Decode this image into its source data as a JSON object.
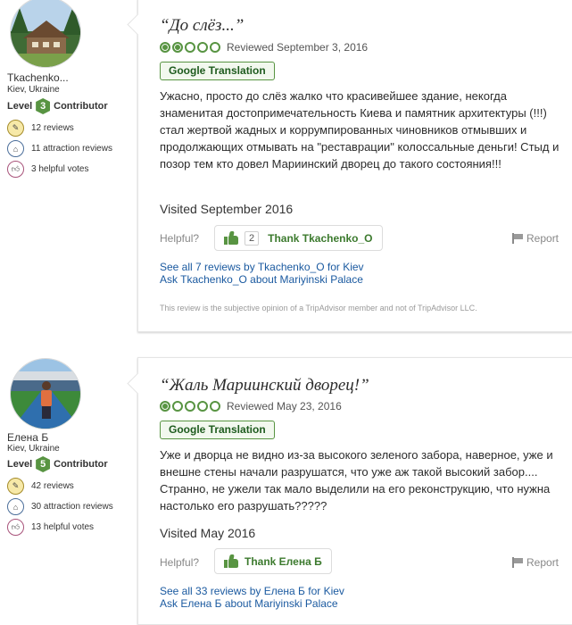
{
  "reviews": [
    {
      "member": {
        "name": "Tkachenko...",
        "location": "Kiev, Ukraine",
        "level_prefix": "Level",
        "level": "3",
        "level_suffix": "Contributor",
        "stats": [
          {
            "icon": "pencil-icon",
            "text": "12 reviews"
          },
          {
            "icon": "attraction-icon",
            "text": "11 attraction reviews"
          },
          {
            "icon": "thumbs-up-icon",
            "text": "3 helpful votes"
          }
        ],
        "avatar": "house-in-forest-photo"
      },
      "quote": "“До слёз...”",
      "rating": 2,
      "reviewed": "Reviewed September 3, 2016",
      "translation_label": "Google Translation",
      "text": "Ужасно, просто до слёз жалко что красивейшее здание, некогда знаменитая достопримечательность Киева и памятник архитектуры (!!!) стал жертвой жадных и коррумпированных чиновников отмывших и продолжающих отмывать на \"реставрации\" колоссальные деньги! Стыд и позор тем кто довел Мариинский дворец до такого состояния!!!",
      "visited": "Visited September 2016",
      "helpful_label": "Helpful?",
      "thank_count": "2",
      "thank_label": "Thank Tkachenko_O",
      "report_label": "Report",
      "link_all": "See all 7 reviews by Tkachenko_O for Kiev",
      "link_ask": "Ask Tkachenko_O about Mariyinski Palace",
      "disclaimer": "This review is the subjective opinion of a TripAdvisor member and not of TripAdvisor LLC."
    },
    {
      "member": {
        "name": "Елена Б",
        "location": "Kiev, Ukraine",
        "level_prefix": "Level",
        "level": "5",
        "level_suffix": "Contributor",
        "stats": [
          {
            "icon": "pencil-icon",
            "text": "42 reviews"
          },
          {
            "icon": "attraction-icon",
            "text": "30 attraction reviews"
          },
          {
            "icon": "thumbs-up-icon",
            "text": "13 helpful votes"
          }
        ],
        "avatar": "woman-in-stadium-photo"
      },
      "quote": "“Жаль Мариинский дворец!”",
      "rating": 1,
      "reviewed": "Reviewed May 23, 2016",
      "translation_label": "Google Translation",
      "text": "Уже и дворца не видно из-за высокого зеленого забора, наверное, уже и внешне стены начали разрушатся, что уже аж такой высокий забор.... Странно, не ужели так мало выделили на его реконструкцию, что нужна настолько его разрушать?????",
      "visited": "Visited May 2016",
      "helpful_label": "Helpful?",
      "thank_label": "Thank Елена Б",
      "report_label": "Report",
      "link_all": "See all 33 reviews by Елена Б for Kiev",
      "link_ask": "Ask Елена Б about Mariyinski Palace"
    }
  ],
  "colors": {
    "accent_green": "#589442",
    "link_blue": "#1b5aa0",
    "level_badge": "#589442"
  }
}
